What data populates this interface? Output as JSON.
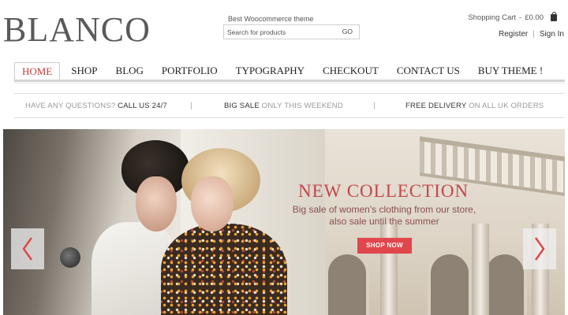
{
  "header": {
    "logo": "BLANCO",
    "tagline": "Best Woocommerce theme",
    "search": {
      "placeholder": "Search for products",
      "go_label": "GO"
    },
    "cart": {
      "label": "Shopping Cart",
      "amount": "£0.00"
    },
    "account": {
      "register": "Register",
      "separator": "|",
      "signin": "Sign In"
    }
  },
  "nav": {
    "items": [
      {
        "label": "HOME",
        "active": true
      },
      {
        "label": "SHOP"
      },
      {
        "label": "BLOG"
      },
      {
        "label": "PORTFOLIO"
      },
      {
        "label": "TYPOGRAPHY"
      },
      {
        "label": "CHECKOUT"
      },
      {
        "label": "CONTACT US"
      },
      {
        "label": "BUY THEME !"
      }
    ]
  },
  "infobar": {
    "item1": {
      "prefix": "HAVE ANY QUESTIONS? ",
      "highlight": "CALL US 24/7"
    },
    "item2": {
      "highlight": "BIG SALE",
      "suffix": " ONLY THIS WEEKEND"
    },
    "item3": {
      "highlight": "FREE DELIVERY",
      "suffix": " ON ALL UK ORDERS"
    },
    "separator": "|"
  },
  "hero": {
    "title": "NEW COLLECTION",
    "subtitle": "Big sale of women's clothing from our store, also sale until the summer",
    "button": "SHOP NOW",
    "prev_icon": "chevron-left-icon",
    "next_icon": "chevron-right-icon"
  },
  "colors": {
    "accent": "#c2474b",
    "button": "#e0474c",
    "logo": "#5a5a5a"
  }
}
